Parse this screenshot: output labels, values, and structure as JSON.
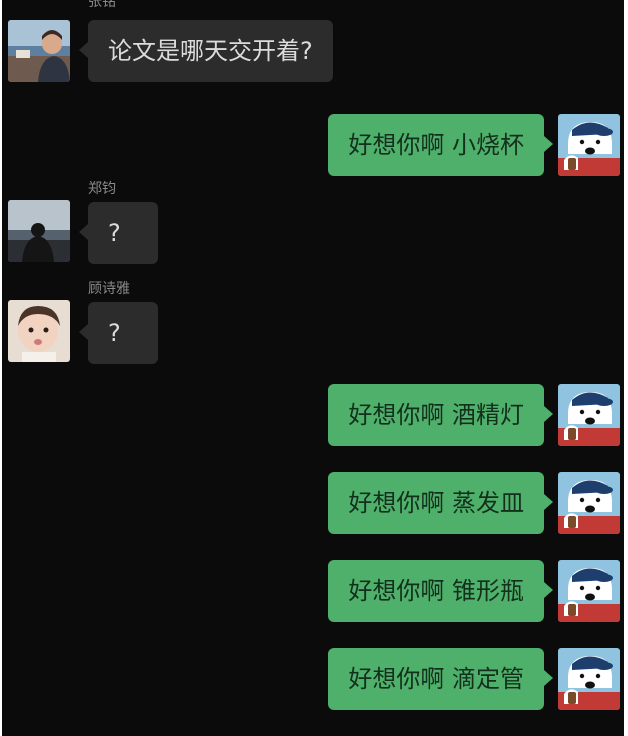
{
  "chat": {
    "messages": [
      {
        "direction": "in",
        "sender": "张铭",
        "text": "论文是哪天交开着?",
        "avatar": "person-avatar"
      },
      {
        "direction": "out",
        "text": "好想你啊 小烧杯",
        "avatar": "polar-bear-avatar"
      },
      {
        "direction": "in",
        "sender": "郑钧",
        "text": "?",
        "avatar": "silhouette-avatar"
      },
      {
        "direction": "in",
        "sender": "顾诗雅",
        "text": "?",
        "avatar": "baby-avatar"
      },
      {
        "direction": "out",
        "text": "好想你啊 酒精灯",
        "avatar": "polar-bear-avatar"
      },
      {
        "direction": "out",
        "text": "好想你啊 蒸发皿",
        "avatar": "polar-bear-avatar"
      },
      {
        "direction": "out",
        "text": "好想你啊 锥形瓶",
        "avatar": "polar-bear-avatar"
      },
      {
        "direction": "out",
        "text": "好想你啊 滴定管",
        "avatar": "polar-bear-avatar"
      }
    ]
  },
  "colors": {
    "background": "#0b0b0b",
    "incoming_bubble": "#2c2c2c",
    "outgoing_bubble": "#4fb06b",
    "sender_name": "#8a8a8a"
  }
}
